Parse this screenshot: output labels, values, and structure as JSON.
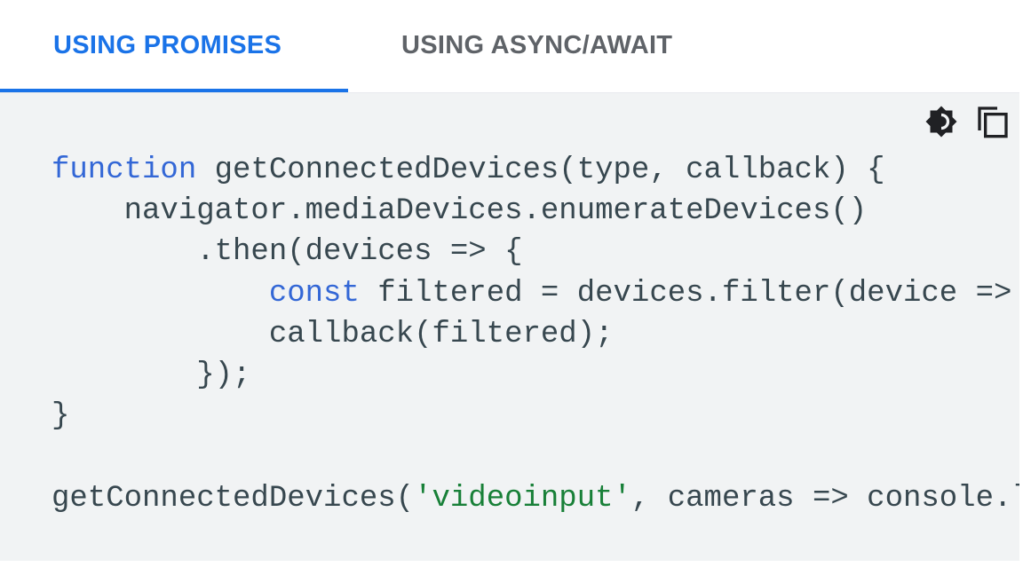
{
  "tabs": [
    {
      "label": "USING PROMISES",
      "active": true
    },
    {
      "label": "USING ASYNC/AWAIT",
      "active": false
    }
  ],
  "toolbar": {
    "theme_icon": "brightness-icon",
    "copy_icon": "copy-icon"
  },
  "colors": {
    "accent": "#1a73e8",
    "keyword": "#3367d6",
    "string": "#188038",
    "text": "#37474f",
    "code_bg": "#f1f3f4"
  },
  "code": {
    "l1_kw": "function",
    "l1_rest": " getConnectedDevices(type, callback) {",
    "l2": "    navigator.mediaDevices.enumerateDevices()",
    "l3": "        .then(devices => {",
    "l4_indent": "            ",
    "l4_kw": "const",
    "l4_rest": " filtered = devices.filter(device =>",
    "l5": "            callback(filtered);",
    "l6": "        });",
    "l7": "}",
    "l9_a": "getConnectedDevices(",
    "l9_str": "'videoinput'",
    "l9_b": ", cameras => console.l"
  }
}
